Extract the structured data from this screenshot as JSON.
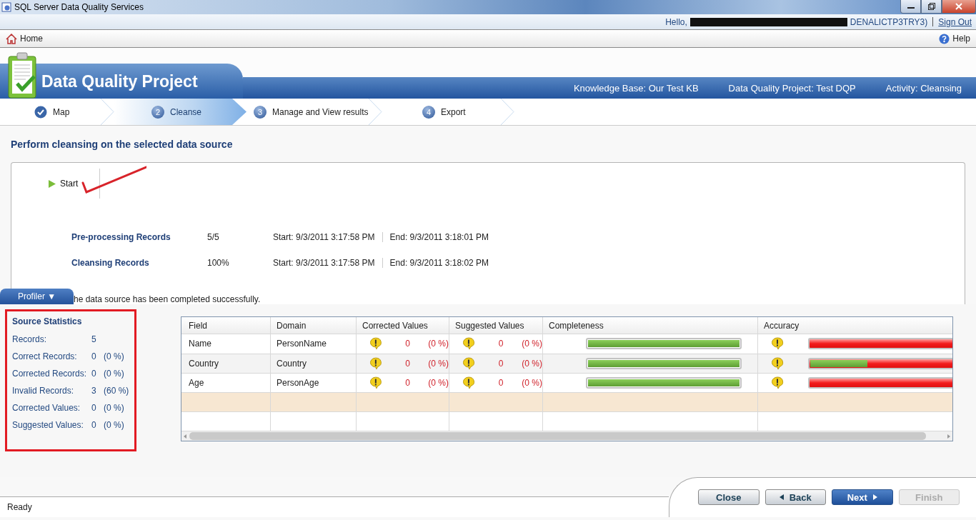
{
  "window": {
    "title": "SQL Server Data Quality Services"
  },
  "user_bar": {
    "greeting": "Hello,",
    "account_suffix": "DENALICTP3TRY3)",
    "sign_out": "Sign Out"
  },
  "nav": {
    "home": "Home",
    "help": "Help"
  },
  "banner": {
    "title": "Data Quality Project",
    "info": [
      "Knowledge Base: Our Test KB",
      "Data Quality Project: Test DQP",
      "Activity: Cleansing"
    ]
  },
  "steps": [
    {
      "label": "Map",
      "completed": true,
      "selected": false
    },
    {
      "number": "2",
      "label": "Cleanse",
      "completed": false,
      "selected": true
    },
    {
      "number": "3",
      "label": "Manage and View results",
      "completed": false,
      "selected": false
    },
    {
      "number": "4",
      "label": "Export",
      "completed": false,
      "selected": false
    }
  ],
  "heading": "Perform cleansing on the selected data source",
  "start_button": "Start",
  "progress": [
    {
      "name": "Pre-processing Records",
      "value": "5/5",
      "start": "Start: 9/3/2011 3:17:58 PM",
      "end": "End: 9/3/2011 3:18:01 PM"
    },
    {
      "name": "Cleansing Records",
      "value": "100%",
      "start": "Start: 9/3/2011 3:17:58 PM",
      "end": "End: 9/3/2011 3:18:02 PM"
    }
  ],
  "message": "he data source has been completed successfully.",
  "profiler": {
    "tab": "Profiler ▼",
    "statistics": {
      "title": "Source Statistics",
      "rows": [
        {
          "label": "Records:",
          "value": "5"
        },
        {
          "label": "Correct Records:",
          "value": "0",
          "percent": "(0 %)"
        },
        {
          "label": "Corrected Records:",
          "value": "0",
          "percent": "(0 %)"
        },
        {
          "label": "Invalid Records:",
          "value": "3",
          "percent": "(60 %)"
        },
        {
          "label": "Corrected Values:",
          "value": "0",
          "percent": "(0 %)"
        },
        {
          "label": "Suggested Values:",
          "value": "0",
          "percent": "(0 %)"
        }
      ]
    },
    "table": {
      "columns": [
        "Field",
        "Domain",
        "Corrected Values",
        "Suggested Values",
        "Completeness",
        "Accuracy"
      ],
      "rows": [
        {
          "kind": "data",
          "selected": false,
          "field": "Name",
          "domain": "PersonName",
          "corrected": {
            "value": "0",
            "percent": "(0 %)"
          },
          "suggested": {
            "value": "0",
            "percent": "(0 %)"
          },
          "completeness": {
            "level": 1
          },
          "accuracy": {
            "level": 0
          }
        },
        {
          "kind": "data",
          "selected": false,
          "field": "Country",
          "domain": "Country",
          "corrected": {
            "value": "0",
            "percent": "(0 %)"
          },
          "suggested": {
            "value": "0",
            "percent": "(0 %)"
          },
          "completeness": {
            "level": 1
          },
          "accuracy": {
            "level": 0.4
          }
        },
        {
          "kind": "data",
          "selected": false,
          "field": "Age",
          "domain": "PersonAge",
          "corrected": {
            "value": "0",
            "percent": "(0 %)"
          },
          "suggested": {
            "value": "0",
            "percent": "(0 %)"
          },
          "completeness": {
            "level": 1
          },
          "accuracy": {
            "level": 0
          }
        },
        {
          "kind": "blank",
          "selected": true
        },
        {
          "kind": "blank",
          "selected": false
        }
      ]
    }
  },
  "buttons": [
    {
      "label": "Close",
      "kind": "default",
      "disabled": false
    },
    {
      "label": "Back",
      "kind": "back",
      "disabled": false
    },
    {
      "label": "Next",
      "kind": "next",
      "disabled": false
    },
    {
      "label": "Finish",
      "kind": "default",
      "disabled": true
    }
  ],
  "status_bar": "Ready"
}
